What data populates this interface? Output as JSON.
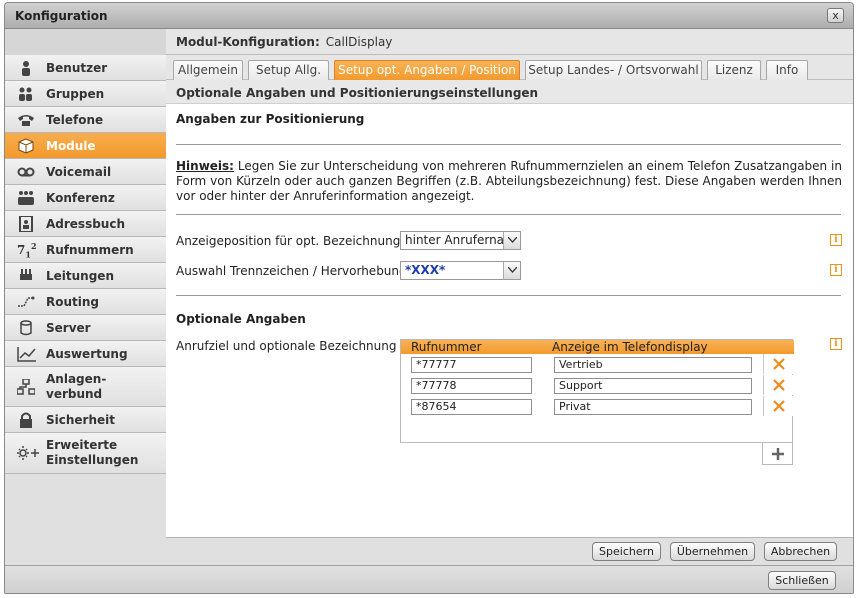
{
  "window": {
    "title": "Konfiguration",
    "close_label": "x"
  },
  "sidebar": {
    "items": [
      {
        "label": "Benutzer",
        "icon": "user-icon"
      },
      {
        "label": "Gruppen",
        "icon": "group-icon"
      },
      {
        "label": "Telefone",
        "icon": "phone-icon"
      },
      {
        "label": "Module",
        "icon": "module-cube-icon",
        "active": true
      },
      {
        "label": "Voicemail",
        "icon": "voicemail-icon"
      },
      {
        "label": "Konferenz",
        "icon": "conference-icon"
      },
      {
        "label": "Adressbuch",
        "icon": "addressbook-icon"
      },
      {
        "label": "Rufnummern",
        "icon": "numbers-icon"
      },
      {
        "label": "Leitungen",
        "icon": "lines-icon"
      },
      {
        "label": "Routing",
        "icon": "routing-icon"
      },
      {
        "label": "Server",
        "icon": "server-icon"
      },
      {
        "label": "Auswertung",
        "icon": "chart-icon"
      },
      {
        "label": "Anlagen-\nverbund",
        "line1": "Anlagen-",
        "line2": "verbund",
        "icon": "network-icon"
      },
      {
        "label": "Sicherheit",
        "icon": "lock-icon"
      },
      {
        "label": "Erweiterte Einstellungen",
        "line1": "Erweiterte",
        "line2": "Einstellungen",
        "icon": "advanced-settings-icon"
      }
    ]
  },
  "module_header": {
    "label": "Modul-Konfiguration:",
    "value": "CallDisplay"
  },
  "tabs": [
    {
      "label": "Allgemein"
    },
    {
      "label": "Setup Allg."
    },
    {
      "label": "Setup opt. Angaben / Position",
      "active": true
    },
    {
      "label": "Setup Landes- / Ortsvorwahl"
    },
    {
      "label": "Lizenz"
    },
    {
      "label": "Info"
    }
  ],
  "section_title": "Optionale Angaben und Positionierungseinstellungen",
  "positioning": {
    "heading": "Angaben zur Positionierung",
    "hint_label": "Hinweis:",
    "hint_text": " Legen Sie zur Unterscheidung von mehreren Rufnummernzielen an einem Telefon Zusatzangaben in Form von Kürzeln oder auch ganzen Begriffen (z.B. Abteilungsbezeichnung) fest. Diese Angaben werden Ihnen vor oder hinter der Anruferinformation angezeigt.",
    "display_position_label": "Anzeigeposition für opt. Bezeichnung",
    "display_position_value": "hinter Anruferna...",
    "separator_label": "Auswahl Trennzeichen / Hervorhebung",
    "separator_value": "*XXX*"
  },
  "optional": {
    "heading": "Optionale Angaben",
    "field_label": "Anrufziel und optionale Bezeichnung",
    "col_number": "Rufnummer",
    "col_display": "Anzeige im Telefondisplay",
    "rows": [
      {
        "number": "*77777",
        "display": "Vertrieb"
      },
      {
        "number": "*77778",
        "display": "Support"
      },
      {
        "number": "*87654",
        "display": "Privat"
      }
    ]
  },
  "buttons": {
    "save": "Speichern",
    "apply": "Übernehmen",
    "cancel": "Abbrechen",
    "close": "Schließen"
  },
  "colors": {
    "accent": "#f39a2c",
    "info": "#e8941e",
    "delete": "#f08a1c"
  }
}
